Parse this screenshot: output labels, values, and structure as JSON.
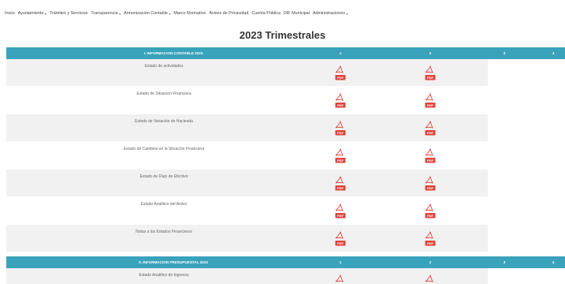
{
  "nav": [
    {
      "label": "Inicio",
      "dropdown": false
    },
    {
      "label": "Ayuntamiento",
      "dropdown": true
    },
    {
      "label": "Trámites y Servicios",
      "dropdown": false
    },
    {
      "label": "Transparencia",
      "dropdown": true
    },
    {
      "label": "Armonización Contable",
      "dropdown": true
    },
    {
      "label": "Marco Normativo",
      "dropdown": false
    },
    {
      "label": "Avisos de Privacidad",
      "dropdown": false
    },
    {
      "label": "Cuenta Pública",
      "dropdown": false
    },
    {
      "label": "DIF Municipal",
      "dropdown": false
    },
    {
      "label": "Administraciones",
      "dropdown": true
    }
  ],
  "page_title": "2023 Trimestrales",
  "sections": [
    {
      "title": "I. INFORMACION CONTABLE 2023",
      "columns": [
        "1",
        "2",
        "3",
        "4"
      ],
      "rows": [
        {
          "label": "Estado de actividades",
          "pdf_columns": [
            1,
            2
          ]
        },
        {
          "label": "Estado de Situación Financiera",
          "pdf_columns": [
            1,
            2
          ]
        },
        {
          "label": "Estado de Variación de Hacienda",
          "pdf_columns": [
            1,
            2
          ]
        },
        {
          "label": "Estado de Cambios en la Situación Financiera",
          "pdf_columns": [
            1,
            2
          ]
        },
        {
          "label": "Estado de Flujo de Efectivo",
          "pdf_columns": [
            1,
            2
          ]
        },
        {
          "label": "Estado Analítico del Activo",
          "pdf_columns": [
            1,
            2
          ]
        },
        {
          "label": "Notas a los Estados Financieros",
          "pdf_columns": [
            1,
            2
          ]
        }
      ]
    },
    {
      "title": "II. INFORMACION PRESUPUESTAL 2023",
      "columns": [
        "1",
        "2",
        "3",
        "4"
      ],
      "rows": [
        {
          "label": "Estado Analítico de Ingresos",
          "pdf_columns": [
            1,
            2
          ]
        }
      ]
    }
  ],
  "icons": {
    "pdf": "pdf-file-icon",
    "pdf_text": "PDF"
  },
  "colors": {
    "header_band": "#3aa3bc",
    "row_alt": "#f1f1f1",
    "pdf_red": "#e0443e"
  }
}
